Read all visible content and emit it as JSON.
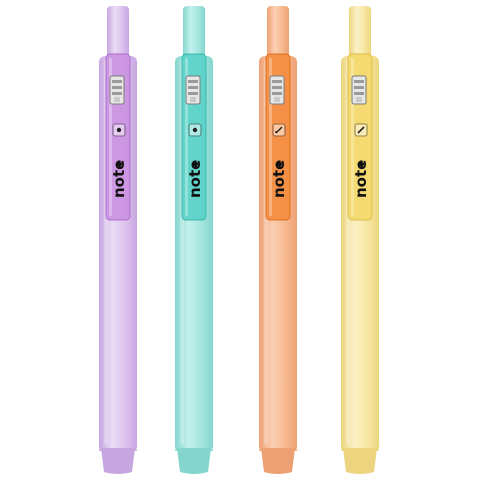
{
  "scene": {
    "background": "#ffffff",
    "subject": "four retractable highlighter pens",
    "brand_text": "note"
  },
  "pens": [
    {
      "color_name": "lilac",
      "body": "#dcc1ee",
      "body_light": "#eadcf6",
      "body_shadow": "#c7a6e0",
      "clip": "#c98fe0",
      "clip_dark": "#a765c6",
      "brand": "note"
    },
    {
      "color_name": "aqua",
      "body": "#a3e6df",
      "body_light": "#c4f1ec",
      "body_shadow": "#84d6cd",
      "clip": "#57d0c6",
      "clip_dark": "#2fb0a6",
      "brand": "note"
    },
    {
      "color_name": "peach",
      "body": "#f7b98f",
      "body_light": "#fbd0b3",
      "body_shadow": "#eda073",
      "clip": "#f48a3b",
      "clip_dark": "#d96a18",
      "brand": "note"
    },
    {
      "color_name": "yellow",
      "body": "#f7e7a3",
      "body_light": "#fbf1c6",
      "body_shadow": "#ecd57e",
      "clip": "#f3d768",
      "clip_dark": "#d9b93c",
      "brand": "note"
    }
  ]
}
